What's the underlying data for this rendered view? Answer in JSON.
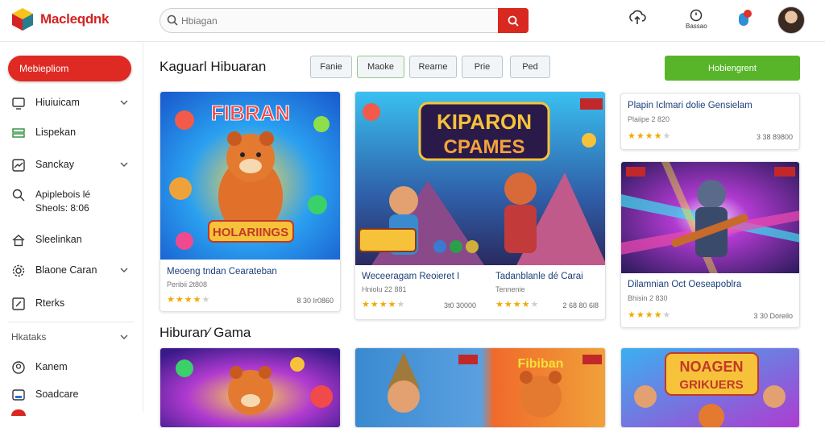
{
  "header": {
    "logo_text": "Macleqdnk",
    "search_placeholder": "Hbiagan",
    "notif_label": "Bassao",
    "brand_accent": "#d8281f"
  },
  "sidebar": {
    "cta_label": "Mebiepliom",
    "items": [
      {
        "label": "Hiuiuicam",
        "icon": "monitor-icon",
        "chevron": true
      },
      {
        "label": "Lispekan",
        "icon": "games-icon",
        "chevron": false
      },
      {
        "label": "Sanckay",
        "icon": "trend-chart-icon",
        "chevron": true
      },
      {
        "label": "Apiplebois lé\nSheols: 8:06",
        "icon": "search-icon",
        "chevron": false
      },
      {
        "label": "Sleelinkan",
        "icon": "home-icon",
        "chevron": false
      },
      {
        "label": "Blaone Caran",
        "icon": "gear-icon",
        "chevron": true
      },
      {
        "label": "Rterks",
        "icon": "pencil-box-icon",
        "chevron": false
      }
    ],
    "section_label": "Hkataks",
    "section_items": [
      {
        "label": "Kanem",
        "icon": "user-icon"
      },
      {
        "label": "Soadcare",
        "icon": "badge-icon"
      }
    ]
  },
  "main": {
    "section1_title": "Kaguarl Hibuaran",
    "filters": [
      "Fanie",
      "Maoke",
      "Rearne",
      "Prie",
      "Ped"
    ],
    "cta_label": "Hobiengrent",
    "section2_title": "Hiburan⁄ Gama",
    "cards": [
      {
        "art_text_top": "FIBRAN",
        "art_text_bottom": "HOLARIINGS",
        "title": "Meoeng tndan Cearateban",
        "sub": "Peribii 2t808",
        "rating": 4,
        "count": "8 30 Ir0860"
      },
      {
        "art_text_top": "KIPARON",
        "art_text_bottom": "CPAMES",
        "title": "Weceeragam Reoieret I",
        "sub": "Hniolu 22 881",
        "rating": 4,
        "count": "3t0 30000"
      },
      {
        "title": "Tadanblanle dé Carai",
        "sub": "Tennenie",
        "rating": 4,
        "count": "2 68 80 6l8"
      },
      {
        "title": "Plapin Iclmari dolie Gensielam",
        "sub": "Plaiipe 2 820",
        "rating": 4,
        "count": "3 38 89800"
      },
      {
        "title": "Dilamnian Oct Oeseapoblra",
        "sub": "Bhisin 2 830",
        "rating": 4,
        "count": "3 30 Doreilo"
      },
      {
        "art_text_top": "Fibiban"
      },
      {
        "art_text_top": "NOAGEN",
        "art_text_bottom": "GRIKUERS"
      }
    ]
  }
}
